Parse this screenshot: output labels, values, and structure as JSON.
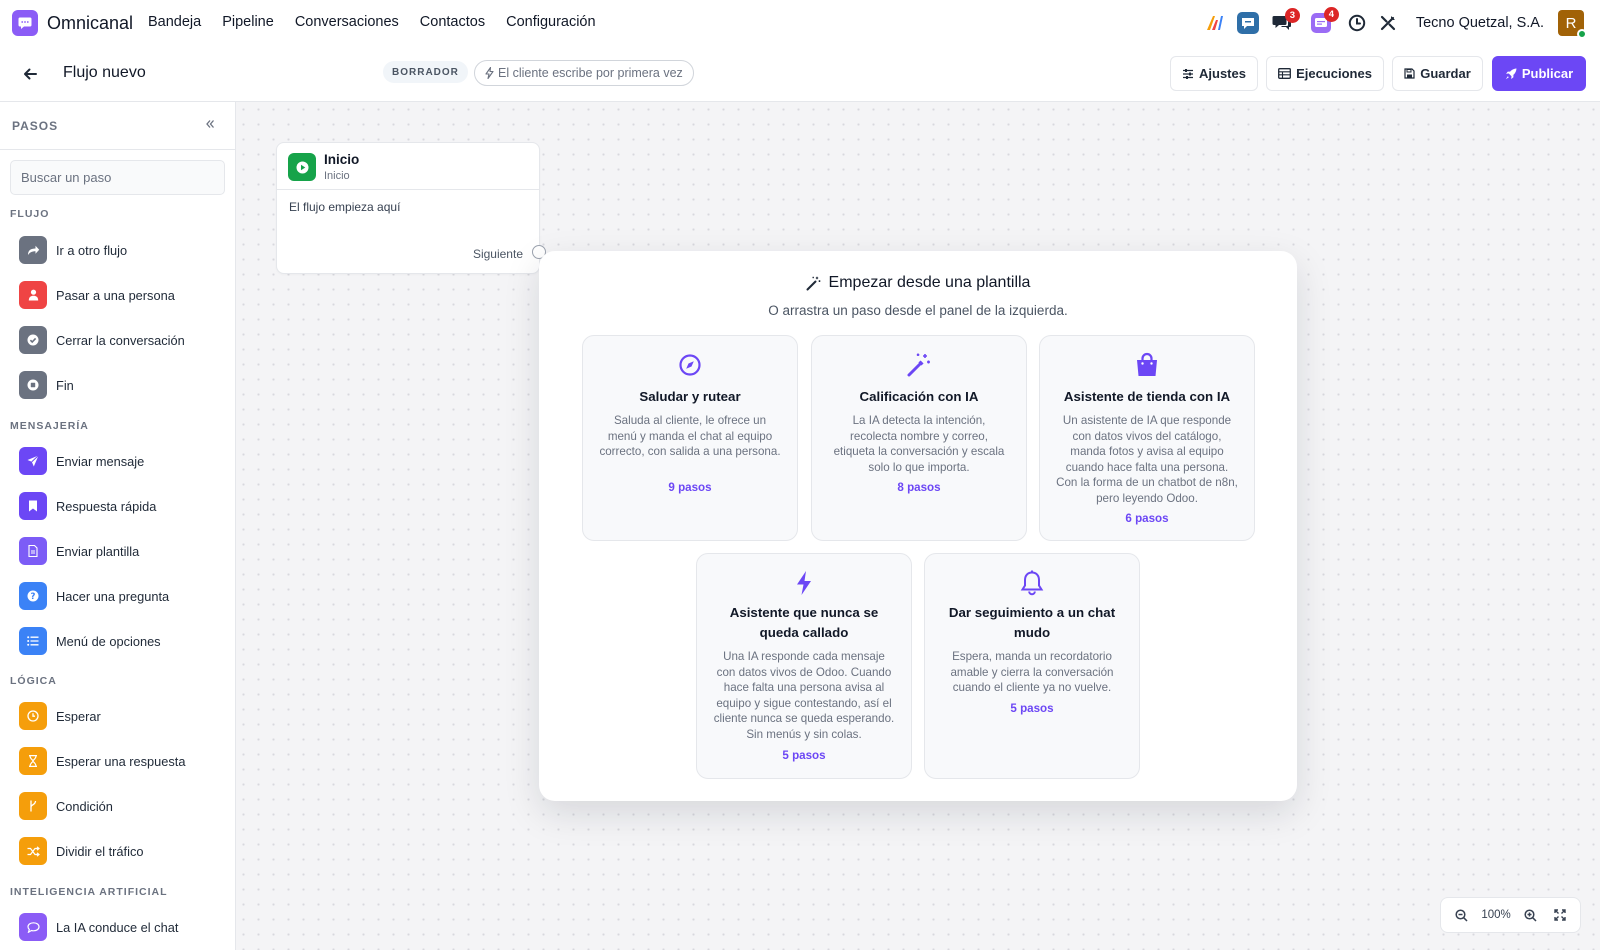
{
  "app": {
    "name": "Omnicanal",
    "accent": "#6c47f5"
  },
  "nav": {
    "items": [
      "Bandeja",
      "Pipeline",
      "Conversaciones",
      "Contactos",
      "Configuración"
    ]
  },
  "systray": {
    "chat_badge": "3",
    "activity_badge": "4",
    "company": "Tecno Quetzal, S.A.",
    "avatar_initial": "R"
  },
  "controlbar": {
    "title": "Flujo nuevo",
    "status": "BORRADOR",
    "trigger": "El cliente escribe por primera vez",
    "settings": "Ajustes",
    "runs": "Ejecuciones",
    "save": "Guardar",
    "publish": "Publicar"
  },
  "sidebar": {
    "title": "PASOS",
    "search_placeholder": "Buscar un paso",
    "sections": [
      {
        "label": "FLUJO",
        "items": [
          {
            "label": "Ir a otro flujo",
            "icon": "redirect-icon",
            "color": "#6b7280"
          },
          {
            "label": "Pasar a una persona",
            "icon": "person-icon",
            "color": "#ef4444"
          },
          {
            "label": "Cerrar la conversación",
            "icon": "check-circle-icon",
            "color": "#6b7280"
          },
          {
            "label": "Fin",
            "icon": "stop-icon",
            "color": "#6b7280"
          }
        ]
      },
      {
        "label": "MENSAJERÍA",
        "items": [
          {
            "label": "Enviar mensaje",
            "icon": "send-icon",
            "color": "#6c47f5"
          },
          {
            "label": "Respuesta rápida",
            "icon": "bookmark-icon",
            "color": "#6c47f5"
          },
          {
            "label": "Enviar plantilla",
            "icon": "file-icon",
            "color": "#7c5cf6"
          },
          {
            "label": "Hacer una pregunta",
            "icon": "question-icon",
            "color": "#3b82f6"
          },
          {
            "label": "Menú de opciones",
            "icon": "list-icon",
            "color": "#3b82f6"
          }
        ]
      },
      {
        "label": "LÓGICA",
        "items": [
          {
            "label": "Esperar",
            "icon": "clock-icon",
            "color": "#f59e0b"
          },
          {
            "label": "Esperar una respuesta",
            "icon": "hourglass-icon",
            "color": "#f59e0b"
          },
          {
            "label": "Condición",
            "icon": "branch-icon",
            "color": "#f59e0b"
          },
          {
            "label": "Dividir el tráfico",
            "icon": "shuffle-icon",
            "color": "#f59e0b"
          }
        ]
      },
      {
        "label": "INTELIGENCIA ARTIFICIAL",
        "items": [
          {
            "label": "La IA conduce el chat",
            "icon": "chat-ai-icon",
            "color": "#8b5cf6"
          }
        ]
      }
    ]
  },
  "start_node": {
    "title": "Inicio",
    "subtitle": "Inicio",
    "description": "El flujo empieza aquí",
    "next_label": "Siguiente"
  },
  "templates": {
    "title": "Empezar desde una plantilla",
    "subtitle": "O arrastra un paso desde el panel de la izquierda.",
    "cards": [
      {
        "title": "Saludar y rutear",
        "description": "Saluda al cliente, le ofrece un menú y manda el chat al equipo correcto, con salida a una persona.",
        "steps": "9 pasos",
        "icon": "compass-icon"
      },
      {
        "title": "Calificación con IA",
        "description": "La IA detecta la intención, recolecta nombre y correo, etiqueta la conversación y escala solo lo que importa.",
        "steps": "8 pasos",
        "icon": "magic-wand-icon"
      },
      {
        "title": "Asistente de tienda con IA",
        "description": "Un asistente de IA que responde con datos vivos del catálogo, manda fotos y avisa al equipo cuando hace falta una persona. Con la forma de un chatbot de n8n, pero leyendo Odoo.",
        "steps": "6 pasos",
        "icon": "shopping-bag-icon"
      },
      {
        "title": "Asistente que nunca se queda callado",
        "description": "Una IA responde cada mensaje con datos vivos de Odoo. Cuando hace falta una persona avisa al equipo y sigue contestando, así el cliente nunca se queda esperando. Sin menús y sin colas.",
        "steps": "5 pasos",
        "icon": "bolt-icon"
      },
      {
        "title": "Dar seguimiento a un chat mudo",
        "description": "Espera, manda un recordatorio amable y cierra la conversación cuando el cliente ya no vuelve.",
        "steps": "5 pasos",
        "icon": "bell-icon"
      }
    ]
  },
  "zoom": {
    "level": "100%"
  }
}
